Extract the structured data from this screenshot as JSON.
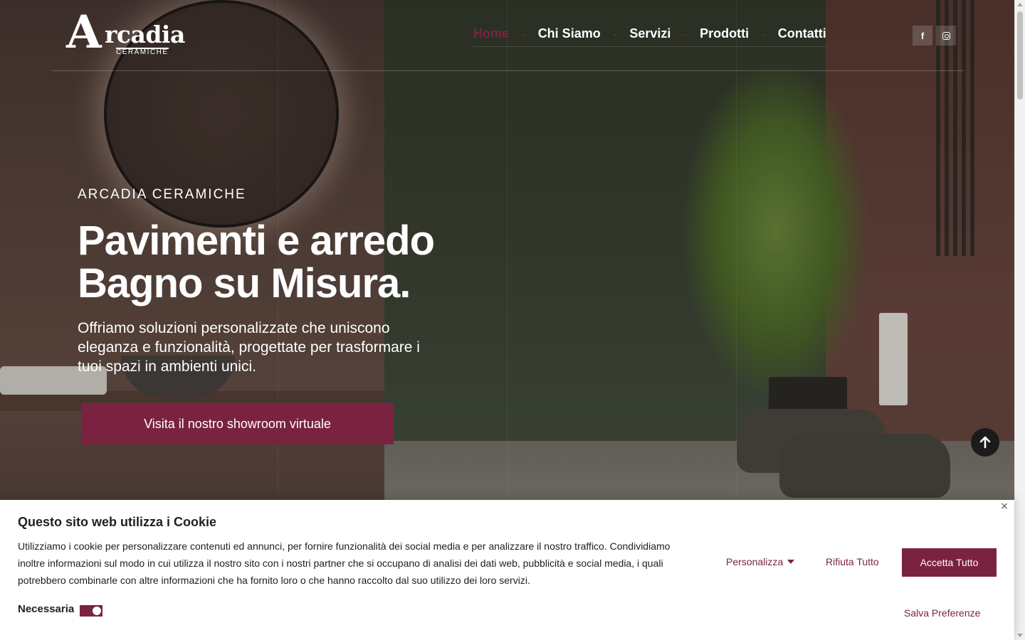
{
  "brand": {
    "logo_initial": "A",
    "logo_rest": "rcadia",
    "logo_sub": "CERAMICHE",
    "accent": "#7a2340"
  },
  "nav": {
    "items": [
      {
        "label": "Home",
        "active": true
      },
      {
        "label": "Chi Siamo",
        "active": false
      },
      {
        "label": "Servizi",
        "active": false
      },
      {
        "label": "Prodotti",
        "active": false
      },
      {
        "label": "Contatti",
        "active": false
      }
    ],
    "separator": "-"
  },
  "social": {
    "facebook_glyph": "f",
    "icons": [
      "facebook-icon",
      "instagram-icon"
    ]
  },
  "hero": {
    "eyebrow": "ARCADIA CERAMICHE",
    "title_line1": "Pavimenti e arredo",
    "title_line2": "Bagno su Misura.",
    "text": "Offriamo soluzioni personalizzate che uniscono eleganza e funzionalità, progettate per trasformare i tuoi spazi in ambienti unici.",
    "cta_label": "Visita il nostro showroom virtuale"
  },
  "cookie_banner": {
    "title": "Questo sito web utilizza i Cookie",
    "close_glyph": "×",
    "text": "Utilizziamo i cookie per personalizzare contenuti ed annunci, per fornire funzionalità dei social media e per analizzare il nostro traffico. Condividiamo inoltre informazioni sul modo in cui utilizza il nostro sito con i nostri partner che si occupano di analisi dei dati web, pubblicità e social media, i quali potrebbero combinarle con altre informazioni che ha fornito loro o che hanno raccolto dal suo utilizzo dei loro servizi.",
    "preference_label": "Necessaria",
    "preference_enabled": true,
    "personalize_label": "Personalizza",
    "reject_label": "Rifiuta Tutto",
    "accept_label": "Accetta Tutto",
    "save_label": "Salva Preferenze"
  }
}
